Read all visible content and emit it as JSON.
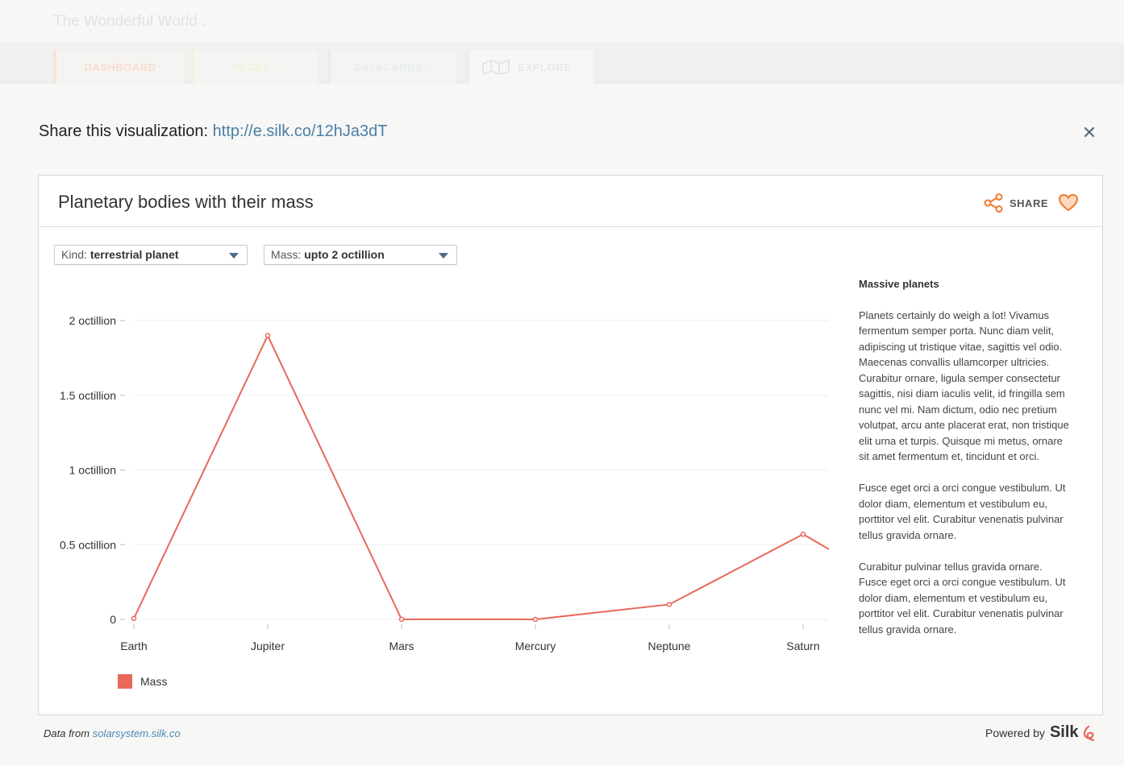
{
  "background_app": {
    "site_title": "The Wonderful World",
    "tabs": [
      {
        "label": "DASHBOARD"
      },
      {
        "label": "PAGES"
      },
      {
        "label": "DATACARDS"
      },
      {
        "label": "EXPLORE"
      }
    ]
  },
  "share": {
    "label": "Share this visualization:",
    "url": "http://e.silk.co/12hJa3dT"
  },
  "card": {
    "title": "Planetary bodies with their mass",
    "share_label": "SHARE",
    "filters": [
      {
        "prefix": "Kind:",
        "value": "terrestrial planet"
      },
      {
        "prefix": "Mass:",
        "value": "upto 2 octillion"
      }
    ],
    "legend_label": "Mass",
    "side_title": "Massive planets",
    "side_paragraphs": [
      "Planets certainly do weigh a lot! Vivamus fermentum semper porta. Nunc diam velit, adipiscing ut tristique vitae, sagittis vel odio. Maecenas convallis ullamcorper ultricies. Curabitur ornare, ligula semper consectetur sagittis, nisi diam iaculis velit, id fringilla sem nunc vel mi. Nam dictum, odio nec pretium volutpat, arcu ante placerat erat, non tristique elit urna et turpis. Quisque mi metus, ornare sit amet fermentum et, tincidunt et orci.",
      "Fusce eget orci a orci congue vestibulum. Ut dolor diam, elementum et vestibulum eu, porttitor vel elit. Curabitur venenatis pulvinar tellus gravida ornare.",
      "Curabitur pulvinar tellus gravida ornare. Fusce eget orci a orci congue vestibulum. Ut dolor diam, elementum et vestibulum eu, porttitor vel elit. Curabitur venenatis pulvinar tellus gravida ornare."
    ]
  },
  "footer": {
    "data_from": "Data from",
    "data_source": "solarsystem.silk.co",
    "powered_by": "Powered by",
    "brand": "Silk"
  },
  "colors": {
    "series": "#e8685a",
    "accent_orange": "#f07a2a",
    "link": "#4a7fa5"
  },
  "chart_data": {
    "type": "line",
    "categories": [
      "Earth",
      "Jupiter",
      "Mars",
      "Mercury",
      "Neptune",
      "Saturn"
    ],
    "series": [
      {
        "name": "Mass",
        "values": [
          0.006,
          1.9,
          0.0006,
          0.0003,
          0.1,
          0.57
        ],
        "trailing_value": 0.47
      }
    ],
    "ylim": [
      0,
      2
    ],
    "yticks": [
      0,
      0.5,
      1,
      1.5,
      2
    ],
    "ytick_labels": [
      "0",
      "0.5 octillion",
      "1 octillion",
      "1.5 octillion",
      "2 octillion"
    ],
    "xlabel": "",
    "ylabel": "",
    "grid": true,
    "legend": "bottom-left"
  }
}
